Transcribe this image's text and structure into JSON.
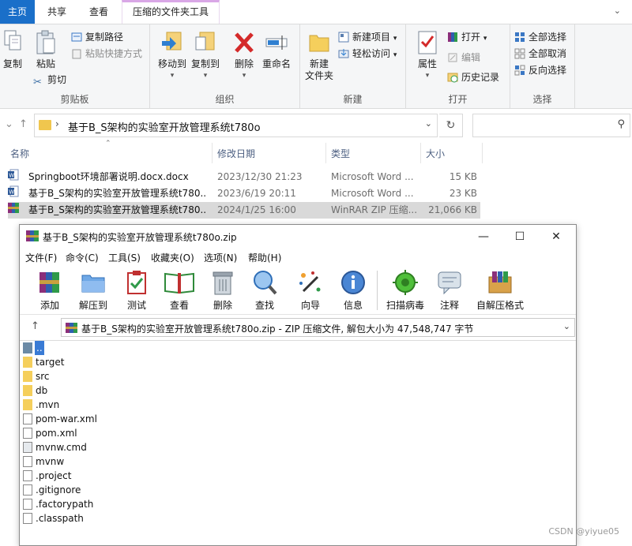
{
  "explorer": {
    "tabs": [
      "主页",
      "共享",
      "查看",
      "压缩的文件夹工具"
    ],
    "ribbon": {
      "clipboard": {
        "label": "剪贴板",
        "copy": "复制",
        "paste": "粘贴",
        "copy_path": "复制路径",
        "paste_shortcut": "粘贴快捷方式",
        "cut": "剪切"
      },
      "organize": {
        "label": "组织",
        "move_to": "移动到",
        "copy_to": "复制到",
        "delete": "删除",
        "rename": "重命名"
      },
      "new": {
        "label": "新建",
        "new_folder": "新建\n文件夹",
        "new_item": "新建项目",
        "easy_access": "轻松访问"
      },
      "open": {
        "label": "打开",
        "properties": "属性",
        "open": "打开",
        "edit": "编辑",
        "history": "历史记录"
      },
      "select": {
        "label": "选择",
        "select_all": "全部选择",
        "select_none": "全部取消",
        "invert": "反向选择"
      }
    },
    "address": {
      "path": "基于B_S架构的实验室开放管理系统t780o",
      "search_placeholder": ""
    },
    "columns": {
      "name": "名称",
      "date": "修改日期",
      "type": "类型",
      "size": "大小"
    },
    "files": [
      {
        "name": "Springboot环境部署说明.docx.docx",
        "date": "2023/12/30 21:23",
        "type": "Microsoft Word ...",
        "size": "15 KB",
        "icon": "word-icon"
      },
      {
        "name": "基于B_S架构的实验室开放管理系统t780...",
        "date": "2023/6/19 20:11",
        "type": "Microsoft Word ...",
        "size": "23 KB",
        "icon": "word-icon"
      },
      {
        "name": "基于B_S架构的实验室开放管理系统t780...",
        "date": "2024/1/25 16:00",
        "type": "WinRAR ZIP 压缩...",
        "size": "21,066 KB",
        "icon": "winrar-icon",
        "selected": true
      }
    ]
  },
  "winrar": {
    "title": "基于B_S架构的实验室开放管理系统t780o.zip",
    "menu": [
      "文件(F)",
      "命令(C)",
      "工具(S)",
      "收藏夹(O)",
      "选项(N)",
      "帮助(H)"
    ],
    "toolbar": [
      "添加",
      "解压到",
      "测试",
      "查看",
      "删除",
      "查找",
      "向导",
      "信息",
      "扫描病毒",
      "注释",
      "自解压格式"
    ],
    "address": "基于B_S架构的实验室开放管理系统t780o.zip - ZIP 压缩文件, 解包大小为 47,548,747 字节",
    "entries": [
      {
        "name": "..",
        "kind": "up"
      },
      {
        "name": "target",
        "kind": "folder"
      },
      {
        "name": "src",
        "kind": "folder"
      },
      {
        "name": "db",
        "kind": "folder"
      },
      {
        "name": ".mvn",
        "kind": "folder"
      },
      {
        "name": "pom-war.xml",
        "kind": "xml"
      },
      {
        "name": "pom.xml",
        "kind": "xml"
      },
      {
        "name": "mvnw.cmd",
        "kind": "cmd"
      },
      {
        "name": "mvnw",
        "kind": "file"
      },
      {
        "name": ".project",
        "kind": "file"
      },
      {
        "name": ".gitignore",
        "kind": "file"
      },
      {
        "name": ".factorypath",
        "kind": "file"
      },
      {
        "name": ".classpath",
        "kind": "file"
      }
    ]
  },
  "watermark": "CSDN @yiyue05"
}
